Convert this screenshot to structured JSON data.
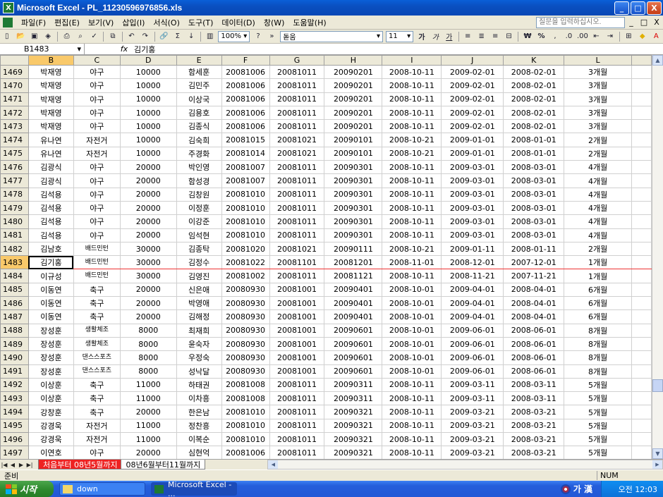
{
  "window": {
    "title": "Microsoft Excel - PL_11230596976856.xls",
    "minimize": "_",
    "maximize": "□",
    "close": "X"
  },
  "menu": {
    "items": [
      "파일(F)",
      "편집(E)",
      "보기(V)",
      "삽입(I)",
      "서식(O)",
      "도구(T)",
      "데이터(D)",
      "창(W)",
      "도움말(H)"
    ],
    "help_placeholder": "질문을 입력하십시오.",
    "doc_minimize": "_",
    "doc_restore": "□",
    "doc_close": "X"
  },
  "toolbar": {
    "zoom": "100%",
    "font_name": "돋움",
    "font_size": "11",
    "bold": "가",
    "italic": "가",
    "underline": "가",
    "currency": "₩",
    "percent": "%"
  },
  "formula_bar": {
    "name_box": "B1483",
    "fx": "fx",
    "value": "김기홍"
  },
  "sheet": {
    "columns": [
      "B",
      "C",
      "D",
      "E",
      "F",
      "G",
      "H",
      "I",
      "J",
      "K",
      "L"
    ],
    "active_column": "B",
    "active_row": "1483",
    "rows": [
      {
        "n": "1469",
        "c": [
          "박재영",
          "야구",
          "10000",
          "함세훈",
          "20081006",
          "20081011",
          "20090201",
          "2008-10-11",
          "2009-02-01",
          "2008-02-01",
          "3개월"
        ]
      },
      {
        "n": "1470",
        "c": [
          "박재영",
          "야구",
          "10000",
          "김민주",
          "20081006",
          "20081011",
          "20090201",
          "2008-10-11",
          "2009-02-01",
          "2008-02-01",
          "3개월"
        ]
      },
      {
        "n": "1471",
        "c": [
          "박재영",
          "야구",
          "10000",
          "이상국",
          "20081006",
          "20081011",
          "20090201",
          "2008-10-11",
          "2009-02-01",
          "2008-02-01",
          "3개월"
        ]
      },
      {
        "n": "1472",
        "c": [
          "박재영",
          "야구",
          "10000",
          "김용호",
          "20081006",
          "20081011",
          "20090201",
          "2008-10-11",
          "2009-02-01",
          "2008-02-01",
          "3개월"
        ]
      },
      {
        "n": "1473",
        "c": [
          "박재영",
          "야구",
          "10000",
          "김종식",
          "20081006",
          "20081011",
          "20090201",
          "2008-10-11",
          "2009-02-01",
          "2008-02-01",
          "3개월"
        ]
      },
      {
        "n": "1474",
        "c": [
          "유나연",
          "자전거",
          "10000",
          "김숙희",
          "20081015",
          "20081021",
          "20090101",
          "2008-10-21",
          "2009-01-01",
          "2008-01-01",
          "2개월"
        ]
      },
      {
        "n": "1475",
        "c": [
          "유나연",
          "자전거",
          "10000",
          "주경화",
          "20081014",
          "20081021",
          "20090101",
          "2008-10-21",
          "2009-01-01",
          "2008-01-01",
          "2개월"
        ]
      },
      {
        "n": "1476",
        "c": [
          "김광식",
          "야구",
          "20000",
          "박인영",
          "20081007",
          "20081011",
          "20090301",
          "2008-10-11",
          "2009-03-01",
          "2008-03-01",
          "4개월"
        ]
      },
      {
        "n": "1477",
        "c": [
          "김광식",
          "야구",
          "20000",
          "함성경",
          "20081007",
          "20081011",
          "20090301",
          "2008-10-11",
          "2009-03-01",
          "2008-03-01",
          "4개월"
        ]
      },
      {
        "n": "1478",
        "c": [
          "김석용",
          "야구",
          "20000",
          "김창원",
          "20081010",
          "20081011",
          "20090301",
          "2008-10-11",
          "2009-03-01",
          "2008-03-01",
          "4개월"
        ]
      },
      {
        "n": "1479",
        "c": [
          "김석용",
          "야구",
          "20000",
          "이정훈",
          "20081010",
          "20081011",
          "20090301",
          "2008-10-11",
          "2009-03-01",
          "2008-03-01",
          "4개월"
        ]
      },
      {
        "n": "1480",
        "c": [
          "김석용",
          "야구",
          "20000",
          "이강준",
          "20081010",
          "20081011",
          "20090301",
          "2008-10-11",
          "2009-03-01",
          "2008-03-01",
          "4개월"
        ]
      },
      {
        "n": "1481",
        "c": [
          "김석용",
          "야구",
          "20000",
          "임석현",
          "20081010",
          "20081011",
          "20090301",
          "2008-10-11",
          "2009-03-01",
          "2008-03-01",
          "4개월"
        ]
      },
      {
        "n": "1482",
        "c": [
          "김남호",
          "배드민턴",
          "30000",
          "김종탁",
          "20081020",
          "20081021",
          "20090111",
          "2008-10-21",
          "2009-01-11",
          "2008-01-11",
          "2개월"
        ]
      },
      {
        "n": "1483",
        "c": [
          "김기홍",
          "배드민턴",
          "30000",
          "김정수",
          "20081022",
          "20081101",
          "20081201",
          "2008-11-01",
          "2008-12-01",
          "2007-12-01",
          "1개월"
        ]
      },
      {
        "n": "1484",
        "c": [
          "이규성",
          "배드민턴",
          "30000",
          "김영진",
          "20081002",
          "20081011",
          "20081121",
          "2008-10-11",
          "2008-11-21",
          "2007-11-21",
          "1개월"
        ]
      },
      {
        "n": "1485",
        "c": [
          "이동연",
          "축구",
          "20000",
          "신은애",
          "20080930",
          "20081001",
          "20090401",
          "2008-10-01",
          "2009-04-01",
          "2008-04-01",
          "6개월"
        ]
      },
      {
        "n": "1486",
        "c": [
          "이동연",
          "축구",
          "20000",
          "박영애",
          "20080930",
          "20081001",
          "20090401",
          "2008-10-01",
          "2009-04-01",
          "2008-04-01",
          "6개월"
        ]
      },
      {
        "n": "1487",
        "c": [
          "이동연",
          "축구",
          "20000",
          "김해정",
          "20080930",
          "20081001",
          "20090401",
          "2008-10-01",
          "2009-04-01",
          "2008-04-01",
          "6개월"
        ]
      },
      {
        "n": "1488",
        "c": [
          "장성훈",
          "생활체조",
          "8000",
          "최재희",
          "20080930",
          "20081001",
          "20090601",
          "2008-10-01",
          "2009-06-01",
          "2008-06-01",
          "8개월"
        ]
      },
      {
        "n": "1489",
        "c": [
          "장성훈",
          "생활체조",
          "8000",
          "윤숙자",
          "20080930",
          "20081001",
          "20090601",
          "2008-10-01",
          "2009-06-01",
          "2008-06-01",
          "8개월"
        ]
      },
      {
        "n": "1490",
        "c": [
          "장성훈",
          "댄스스포츠",
          "8000",
          "우정숙",
          "20080930",
          "20081001",
          "20090601",
          "2008-10-01",
          "2009-06-01",
          "2008-06-01",
          "8개월"
        ]
      },
      {
        "n": "1491",
        "c": [
          "장성훈",
          "댄스스포츠",
          "8000",
          "성낙달",
          "20080930",
          "20081001",
          "20090601",
          "2008-10-01",
          "2009-06-01",
          "2008-06-01",
          "8개월"
        ]
      },
      {
        "n": "1492",
        "c": [
          "이상훈",
          "축구",
          "11000",
          "하태권",
          "20081008",
          "20081011",
          "20090311",
          "2008-10-11",
          "2009-03-11",
          "2008-03-11",
          "5개월"
        ]
      },
      {
        "n": "1493",
        "c": [
          "이상훈",
          "축구",
          "11000",
          "이차흥",
          "20081008",
          "20081011",
          "20090311",
          "2008-10-11",
          "2009-03-11",
          "2008-03-11",
          "5개월"
        ]
      },
      {
        "n": "1494",
        "c": [
          "강창훈",
          "축구",
          "20000",
          "한은남",
          "20081010",
          "20081011",
          "20090321",
          "2008-10-11",
          "2009-03-21",
          "2008-03-21",
          "5개월"
        ]
      },
      {
        "n": "1495",
        "c": [
          "강경욱",
          "자전거",
          "11000",
          "정찬흥",
          "20081010",
          "20081011",
          "20090321",
          "2008-10-11",
          "2009-03-21",
          "2008-03-21",
          "5개월"
        ]
      },
      {
        "n": "1496",
        "c": [
          "강경욱",
          "자전거",
          "11000",
          "이복순",
          "20081010",
          "20081011",
          "20090321",
          "2008-10-11",
          "2009-03-21",
          "2008-03-21",
          "5개월"
        ]
      },
      {
        "n": "1497",
        "c": [
          "이연호",
          "야구",
          "20000",
          "심현억",
          "20081006",
          "20081011",
          "20090321",
          "2008-10-11",
          "2009-03-21",
          "2008-03-21",
          "5개월"
        ]
      },
      {
        "n": "1498",
        "c": [
          "이연호",
          "야구",
          "20000",
          "최정민",
          "20081006",
          "20081011",
          "20090321",
          "2008-10-11",
          "2009-03-21",
          "2008-03-21",
          "5개월"
        ]
      }
    ]
  },
  "sheet_tabs": {
    "nav": [
      "|◀",
      "◀",
      "▶",
      "▶|"
    ],
    "tabs": [
      {
        "label": "처음부터 08년5월까지",
        "style": "red"
      },
      {
        "label": "08년6월부터11월까지",
        "style": "active"
      }
    ]
  },
  "status": {
    "ready": "준비",
    "num": "NUM"
  },
  "taskbar": {
    "start": "시작",
    "tasks": [
      "down",
      "Microsoft Excel - ..."
    ],
    "ime": "가 漢",
    "clock": "오전 12:03"
  }
}
